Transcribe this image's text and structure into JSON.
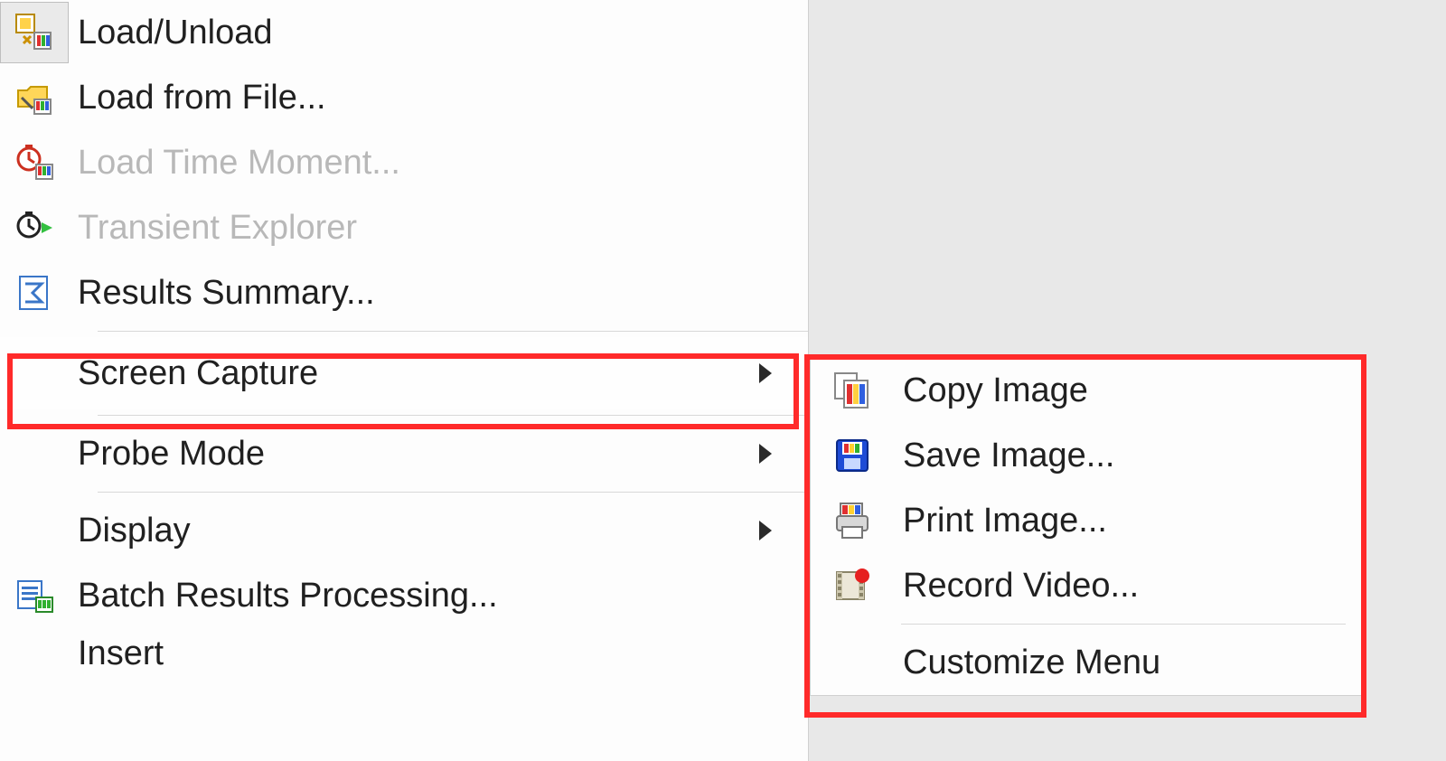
{
  "menu": {
    "items": [
      {
        "label": "Load/Unload",
        "enabled": true,
        "submenu": false,
        "icon": "load-unload-icon"
      },
      {
        "label": "Load from File...",
        "enabled": true,
        "submenu": false,
        "icon": "load-file-icon"
      },
      {
        "label": "Load Time Moment...",
        "enabled": false,
        "submenu": false,
        "icon": "time-moment-icon"
      },
      {
        "label": "Transient Explorer",
        "enabled": false,
        "submenu": false,
        "icon": "transient-explorer-icon"
      },
      {
        "label": "Results Summary...",
        "enabled": true,
        "submenu": false,
        "icon": "sigma-icon"
      },
      {
        "sep": true
      },
      {
        "label": "Screen Capture",
        "enabled": true,
        "submenu": true,
        "highlight": true
      },
      {
        "sep": true
      },
      {
        "label": "Probe Mode",
        "enabled": true,
        "submenu": true
      },
      {
        "sep": true
      },
      {
        "label": "Display",
        "enabled": true,
        "submenu": true
      },
      {
        "label": "Batch Results Processing...",
        "enabled": true,
        "submenu": false,
        "icon": "batch-icon"
      },
      {
        "label": "Insert",
        "enabled": true,
        "submenu": true
      }
    ]
  },
  "submenu": {
    "title": "Screen Capture",
    "items": [
      {
        "label": "Copy Image",
        "icon": "copy-image-icon"
      },
      {
        "label": "Save Image...",
        "icon": "save-image-icon"
      },
      {
        "label": "Print Image...",
        "icon": "print-image-icon"
      },
      {
        "label": "Record Video...",
        "icon": "record-video-icon"
      },
      {
        "sep": true
      },
      {
        "label": "Customize Menu"
      }
    ],
    "highlight": true
  }
}
